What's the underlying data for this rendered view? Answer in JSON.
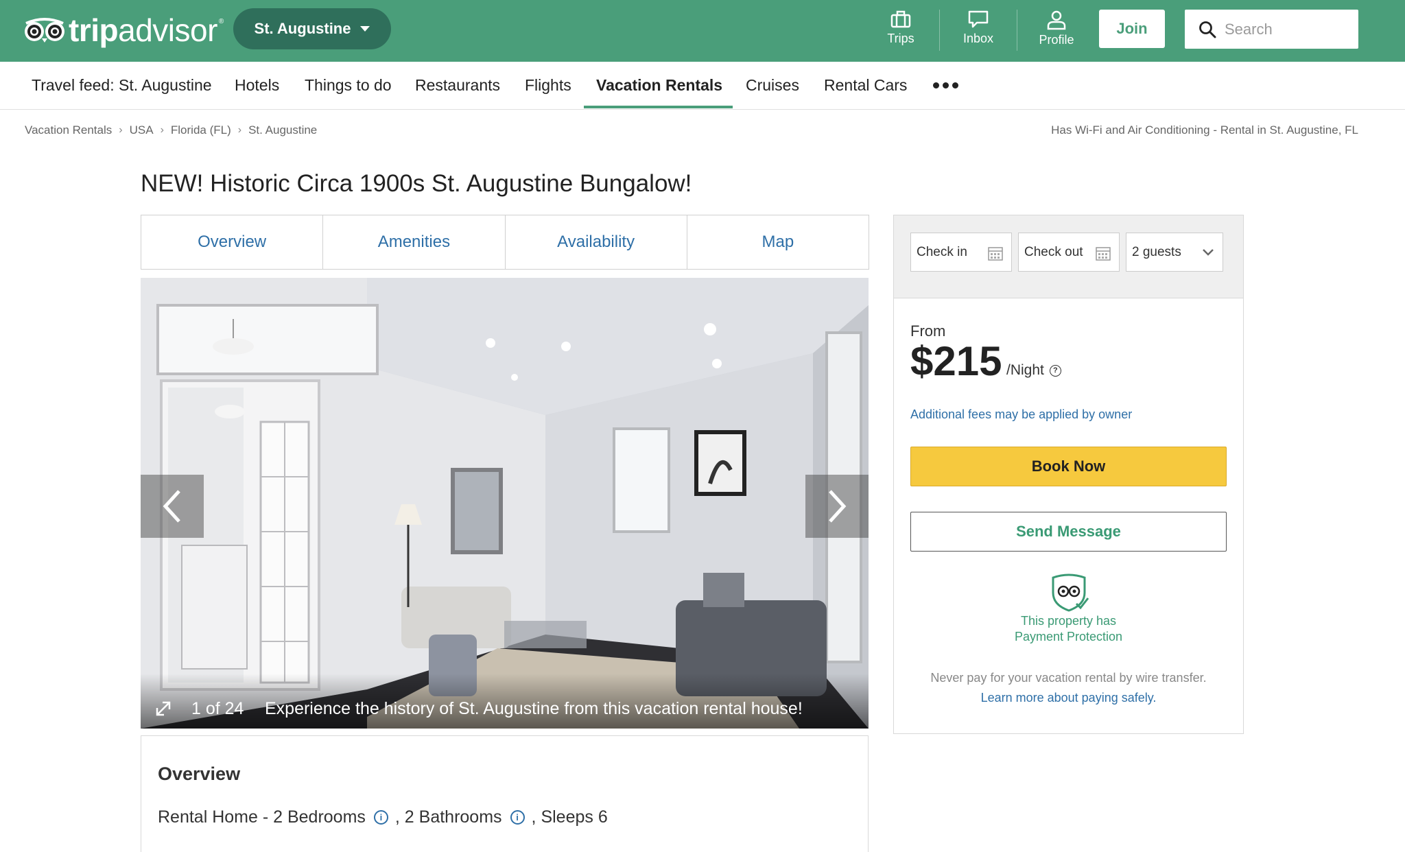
{
  "header": {
    "logo_text_bold": "trip",
    "logo_text_regular": "advisor",
    "location": "St. Augustine",
    "nav": [
      {
        "label": "Trips",
        "icon": "briefcase-icon"
      },
      {
        "label": "Inbox",
        "icon": "chat-bubble-icon"
      },
      {
        "label": "Profile",
        "icon": "person-icon"
      }
    ],
    "join_label": "Join",
    "search_placeholder": "Search",
    "brand_color": "#4a9e7a"
  },
  "subnav": {
    "items": [
      "Travel feed: St. Augustine",
      "Hotels",
      "Things to do",
      "Restaurants",
      "Flights",
      "Vacation Rentals",
      "Cruises",
      "Rental Cars"
    ],
    "active": "Vacation Rentals"
  },
  "breadcrumb": {
    "items": [
      "Vacation Rentals",
      "USA",
      "Florida (FL)",
      "St. Augustine"
    ],
    "right_text": "Has Wi-Fi and Air Conditioning - Rental in St. Augustine, FL"
  },
  "listing": {
    "title": "NEW! Historic Circa 1900s St. Augustine Bungalow!",
    "tabs": [
      "Overview",
      "Amenities",
      "Availability",
      "Map"
    ],
    "photo": {
      "count": "1 of 24",
      "caption": "Experience the history of St. Augustine from this vacation rental house!"
    },
    "overview": {
      "heading": "Overview",
      "type": "Rental Home - 2 Bedrooms",
      "bathrooms": ", 2 Bathrooms",
      "sleeps": ", Sleeps 6"
    }
  },
  "booking": {
    "check_in": "Check in",
    "check_out": "Check out",
    "guests": "2 guests",
    "from_label": "From",
    "price": "$215",
    "per_night": "/Night",
    "fees_note": "Additional fees may be applied by owner",
    "book_label": "Book Now",
    "message_label": "Send Message",
    "protection_line1": "This property has",
    "protection_line2": "Payment Protection",
    "wire_note": "Never pay for your vacation rental by wire transfer.",
    "wire_link": "Learn more about paying safely."
  }
}
